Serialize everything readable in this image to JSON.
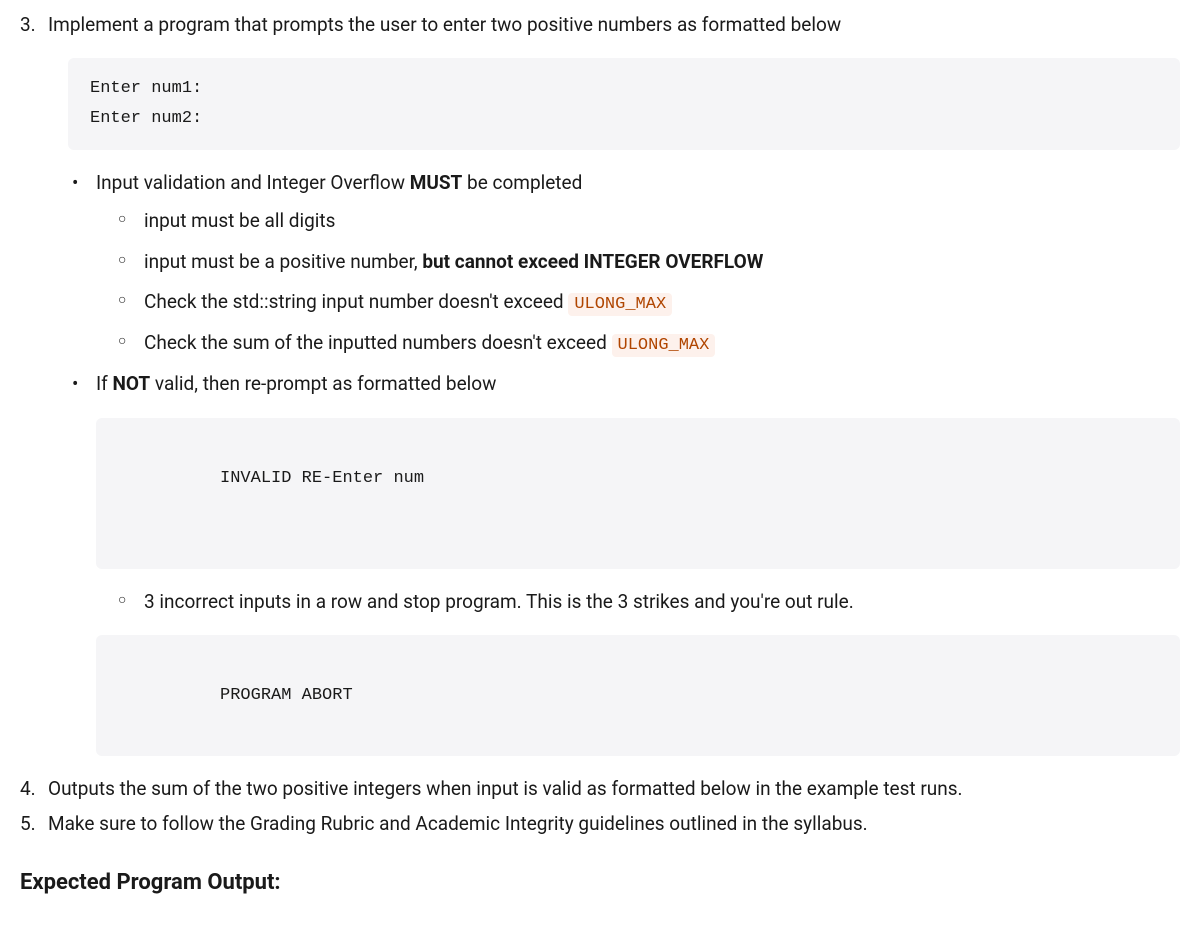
{
  "item3": {
    "number": "3.",
    "text": "Implement a program that prompts the user to enter two positive numbers as formatted below",
    "code1": "Enter num1:\nEnter num2:",
    "bullets": {
      "b1_pre": "Input validation and Integer Overflow ",
      "b1_bold": "MUST",
      "b1_post": " be completed",
      "sub1": "input must be all digits",
      "sub2_pre": "input must be a positive number, ",
      "sub2_bold": "but cannot exceed INTEGER OVERFLOW",
      "sub3_pre": "Check the std::string input number doesn't exceed ",
      "sub3_code": "ULONG_MAX",
      "sub4_pre": "Check the sum of the inputted numbers doesn't exceed ",
      "sub4_code": "ULONG_MAX",
      "b2_pre": "If ",
      "b2_bold": "NOT",
      "b2_post": " valid, then re-prompt as formatted below",
      "code2": "INVALID RE-Enter num",
      "sub5": "3 incorrect inputs in a row and stop program. This is the 3 strikes and you're out rule.",
      "code3": "PROGRAM ABORT"
    }
  },
  "item4": {
    "number": "4.",
    "text": "Outputs the sum of the two positive integers when input is valid as formatted below in the example test runs."
  },
  "item5": {
    "number": "5.",
    "text": "Make sure to follow the Grading Rubric and Academic Integrity guidelines outlined in the syllabus."
  },
  "heading": "Expected Program Output:"
}
